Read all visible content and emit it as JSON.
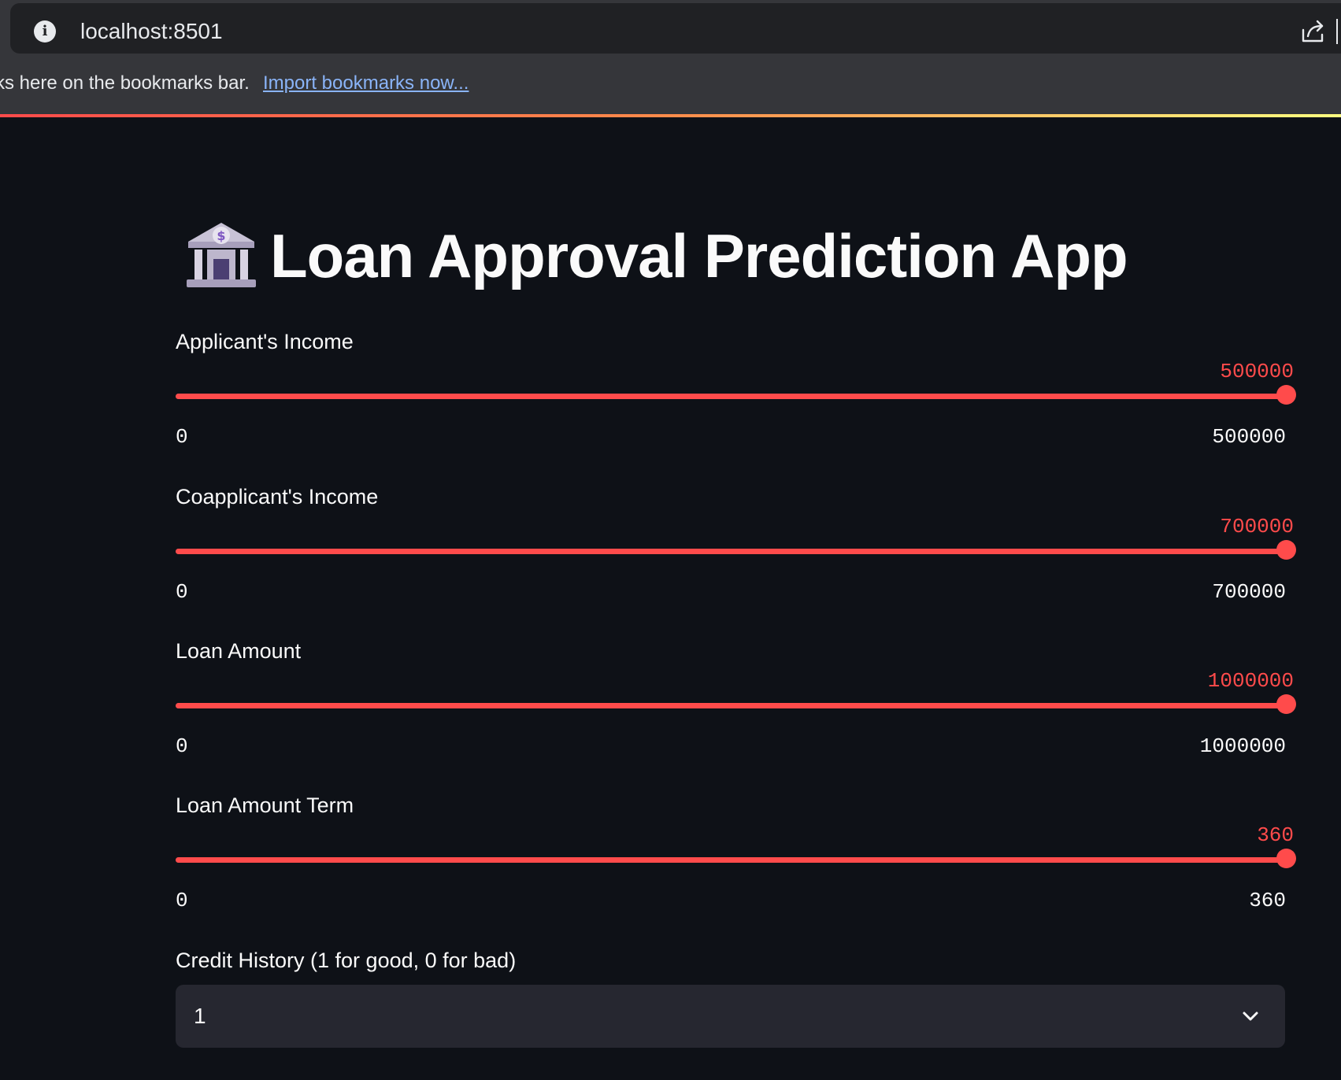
{
  "browser": {
    "url": "localhost:8501",
    "bookmarks_text": "rks here on the bookmarks bar.",
    "bookmarks_link": "Import bookmarks now..."
  },
  "app": {
    "title": "Loan Approval Prediction App",
    "title_icon": "bank-icon",
    "accent_color": "#ff4b4b",
    "background_color": "#0e1117"
  },
  "sliders": [
    {
      "label": "Applicant's Income",
      "value": "500000",
      "min": "0",
      "max": "500000",
      "fraction": 1.0
    },
    {
      "label": "Coapplicant's Income",
      "value": "700000",
      "min": "0",
      "max": "700000",
      "fraction": 1.0
    },
    {
      "label": "Loan Amount",
      "value": "1000000",
      "min": "0",
      "max": "1000000",
      "fraction": 1.0
    },
    {
      "label": "Loan Amount Term",
      "value": "360",
      "min": "0",
      "max": "360",
      "fraction": 1.0
    }
  ],
  "credit_history": {
    "label": "Credit History (1 for good, 0 for bad)",
    "selected": "1",
    "icon": "chevron-down-icon"
  }
}
